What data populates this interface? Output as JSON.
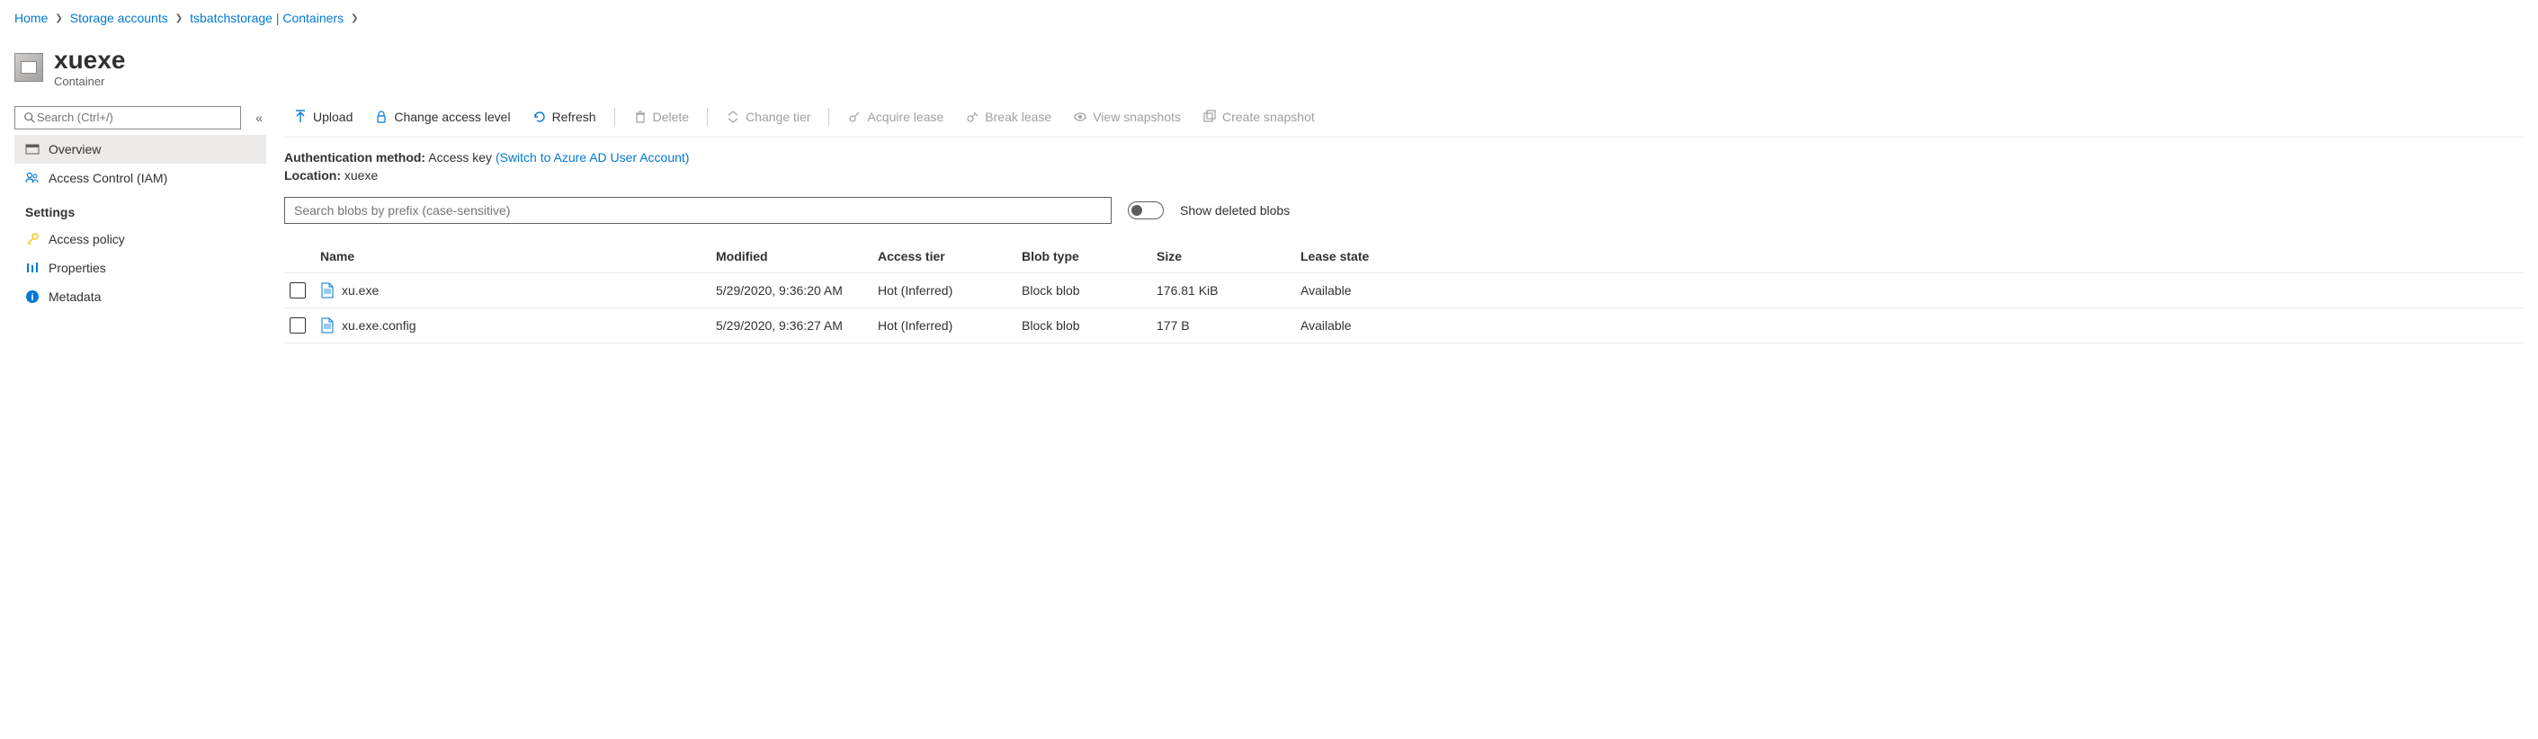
{
  "breadcrumb": [
    {
      "label": "Home"
    },
    {
      "label": "Storage accounts"
    },
    {
      "label": "tsbatchstorage | Containers"
    }
  ],
  "header": {
    "title": "xuexe",
    "subtitle": "Container"
  },
  "sidebar": {
    "search_placeholder": "Search (Ctrl+/)",
    "items": [
      {
        "label": "Overview",
        "icon": "overview",
        "selected": true
      },
      {
        "label": "Access Control (IAM)",
        "icon": "iam",
        "selected": false
      }
    ],
    "section_label": "Settings",
    "settings_items": [
      {
        "label": "Access policy",
        "icon": "key"
      },
      {
        "label": "Properties",
        "icon": "properties"
      },
      {
        "label": "Metadata",
        "icon": "info"
      }
    ]
  },
  "toolbar": [
    {
      "label": "Upload",
      "icon": "upload",
      "disabled": false
    },
    {
      "label": "Change access level",
      "icon": "lock",
      "disabled": false
    },
    {
      "label": "Refresh",
      "icon": "refresh",
      "disabled": false
    },
    {
      "sep": true
    },
    {
      "label": "Delete",
      "icon": "delete",
      "disabled": true
    },
    {
      "sep": true
    },
    {
      "label": "Change tier",
      "icon": "tier",
      "disabled": true
    },
    {
      "sep": true
    },
    {
      "label": "Acquire lease",
      "icon": "acquire",
      "disabled": true
    },
    {
      "label": "Break lease",
      "icon": "break",
      "disabled": true
    },
    {
      "label": "View snapshots",
      "icon": "view",
      "disabled": true
    },
    {
      "label": "Create snapshot",
      "icon": "snapshot",
      "disabled": true
    }
  ],
  "info": {
    "auth_label": "Authentication method:",
    "auth_value": "Access key",
    "auth_link": "(Switch to Azure AD User Account)",
    "loc_label": "Location:",
    "loc_value": "xuexe"
  },
  "blob_search_placeholder": "Search blobs by prefix (case-sensitive)",
  "toggle_label": "Show deleted blobs",
  "table": {
    "columns": [
      "Name",
      "Modified",
      "Access tier",
      "Blob type",
      "Size",
      "Lease state"
    ],
    "rows": [
      {
        "name": "xu.exe",
        "modified": "5/29/2020, 9:36:20 AM",
        "tier": "Hot (Inferred)",
        "type": "Block blob",
        "size": "176.81 KiB",
        "lease": "Available"
      },
      {
        "name": "xu.exe.config",
        "modified": "5/29/2020, 9:36:27 AM",
        "tier": "Hot (Inferred)",
        "type": "Block blob",
        "size": "177 B",
        "lease": "Available"
      }
    ]
  }
}
